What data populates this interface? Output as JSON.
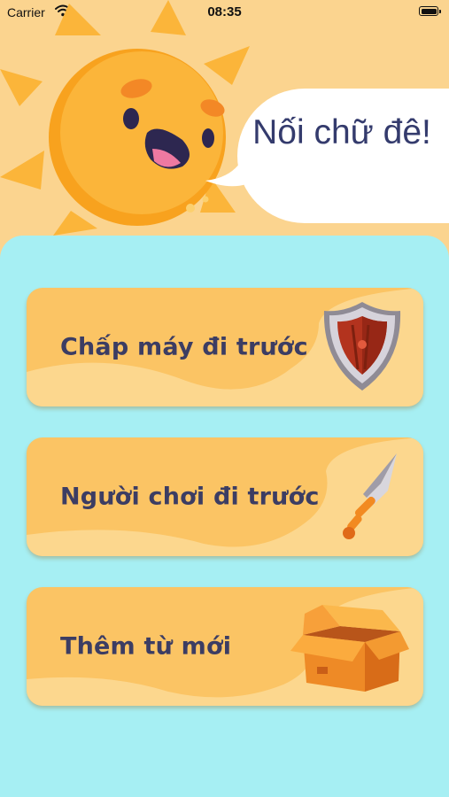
{
  "status_bar": {
    "carrier": "Carrier",
    "time": "08:35"
  },
  "header": {
    "speech": "Nối chữ đê!"
  },
  "menu": [
    {
      "label": "Chấp máy đi trước",
      "icon": "shield-icon"
    },
    {
      "label": "Người chơi đi trước",
      "icon": "sword-icon"
    },
    {
      "label": "Thêm từ mới",
      "icon": "open-box-icon"
    }
  ],
  "colors": {
    "background": "#fbd48f",
    "panel": "#a6eff3",
    "card": "#fbc464",
    "text": "#3c3d63",
    "speech_text": "#343b6d"
  }
}
